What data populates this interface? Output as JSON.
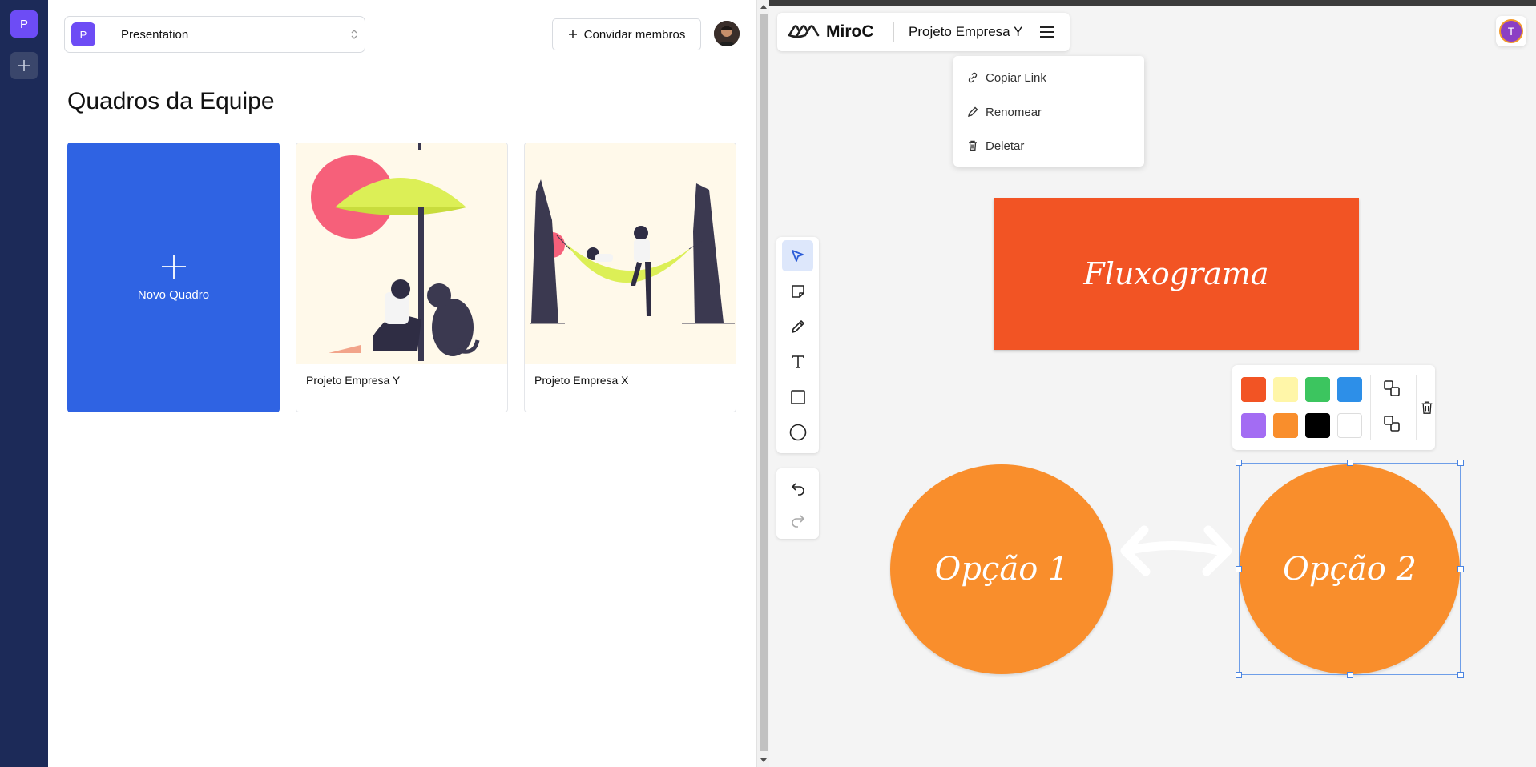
{
  "org_rail": {
    "org_initial": "P",
    "add_label": "+"
  },
  "dashboard": {
    "org_selector": {
      "initial": "P",
      "label": "Presentation"
    },
    "invite_label": "Convidar membros",
    "title": "Quadros da Equipe",
    "new_board_label": "Novo Quadro",
    "boards": [
      {
        "name": "Projeto Empresa Y",
        "illustration": "person-with-dog-under-umbrella"
      },
      {
        "name": "Projeto Empresa X",
        "illustration": "person-in-hammock"
      }
    ]
  },
  "board": {
    "brand": "MiroC",
    "board_name": "Projeto Empresa Y",
    "user_initial": "T",
    "menu": [
      {
        "label": "Copiar Link",
        "icon": "link-icon"
      },
      {
        "label": "Renomear",
        "icon": "pencil-icon"
      },
      {
        "label": "Deletar",
        "icon": "trash-icon"
      }
    ],
    "tools": [
      "select-tool",
      "sticky-note-tool",
      "pen-tool",
      "text-tool",
      "rectangle-tool",
      "ellipse-tool"
    ],
    "history": [
      "undo",
      "redo"
    ],
    "canvas": {
      "rectangle_text": "Fluxograma",
      "oval_1_text": "Opção 1",
      "oval_2_text": "Opção 2"
    },
    "colors": [
      "#f25424",
      "#fff6a8",
      "#3cc55f",
      "#2d8fe8",
      "#a36cf3",
      "#f98e2c",
      "#000000",
      "#ffffff"
    ]
  }
}
